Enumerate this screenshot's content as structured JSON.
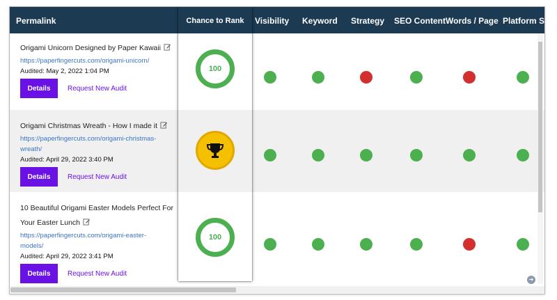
{
  "header": {
    "columns": [
      "Permalink",
      "Chance to Rank",
      "Visibility",
      "Keyword",
      "Strategy",
      "SEO Content",
      "Words / Page",
      "Platform SE"
    ]
  },
  "colors": {
    "green": "#4caf50",
    "red": "#d32f2f",
    "header_bg": "#1c3a52",
    "button": "#6a11e6",
    "link": "#3b74c4"
  },
  "rows": [
    {
      "title": "Origami Unicorn Designed by Paper Kawaii",
      "url": "https://paperfingercuts.com/origami-unicorn/",
      "audited_label": "Audited:",
      "audited_date": "May 2, 2022 1:04 PM",
      "details_label": "Details",
      "audit_label": "Request New Audit",
      "rank": {
        "type": "score",
        "value": "100"
      },
      "statuses": [
        "green",
        "green",
        "red",
        "green",
        "red",
        "green"
      ]
    },
    {
      "title": "Origami Christmas Wreath - How I made it",
      "url": "https://paperfingercuts.com/origami-christmas-wreath/",
      "audited_label": "Audited:",
      "audited_date": "April 29, 2022 3:40 PM",
      "details_label": "Details",
      "audit_label": "Request New Audit",
      "rank": {
        "type": "trophy",
        "icon": "trophy-icon"
      },
      "statuses": [
        "green",
        "green",
        "green",
        "green",
        "green",
        "green"
      ]
    },
    {
      "title": "10 Beautiful Origami Easter Models Perfect For Your Easter Lunch",
      "url": "https://paperfingercuts.com/origami-easter-models/",
      "audited_label": "Audited:",
      "audited_date": "April 29, 2022 3:41 PM",
      "details_label": "Details",
      "audit_label": "Request New Audit",
      "rank": {
        "type": "score",
        "value": "100"
      },
      "statuses": [
        "green",
        "green",
        "green",
        "green",
        "red",
        "green"
      ]
    }
  ]
}
